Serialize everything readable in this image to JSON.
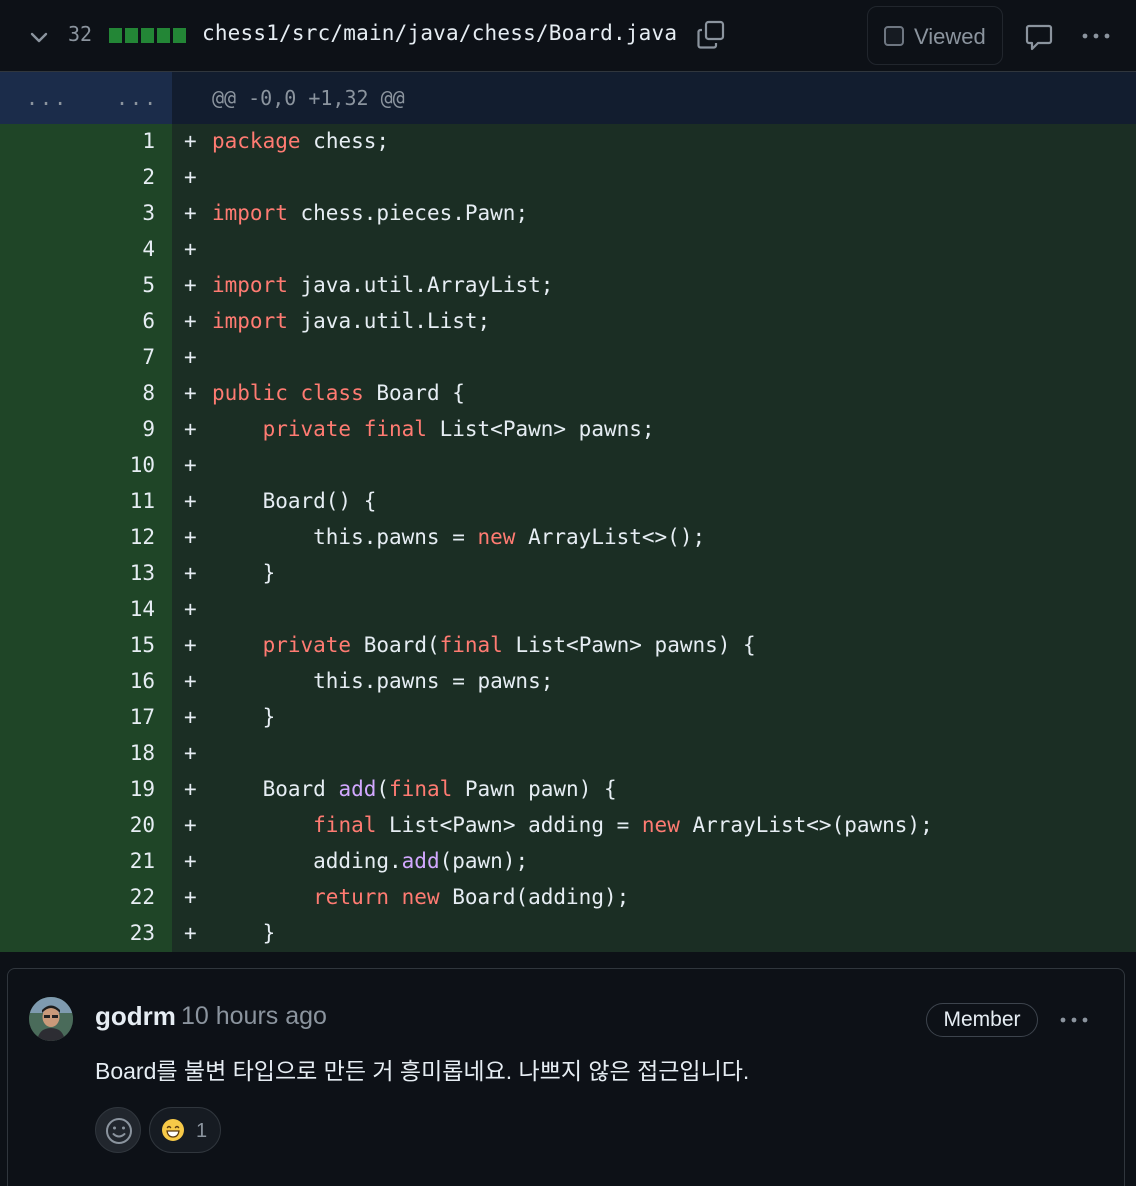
{
  "file": {
    "additions": "32",
    "path": "chess1/src/main/java/chess/Board.java",
    "viewed_label": "Viewed"
  },
  "hunk": {
    "old_marker": "...",
    "new_marker": "...",
    "header": "@@ -0,0 +1,32 @@"
  },
  "lines": [
    {
      "n": "1",
      "code": [
        [
          "kw",
          "package"
        ],
        [
          "",
          "chess;"
        ]
      ]
    },
    {
      "n": "2",
      "code": []
    },
    {
      "n": "3",
      "code": [
        [
          "kw",
          "import"
        ],
        [
          "",
          "chess.pieces.Pawn;"
        ]
      ]
    },
    {
      "n": "4",
      "code": []
    },
    {
      "n": "5",
      "code": [
        [
          "kw",
          "import"
        ],
        [
          "",
          "java.util.ArrayList;"
        ]
      ]
    },
    {
      "n": "6",
      "code": [
        [
          "kw",
          "import"
        ],
        [
          "",
          "java.util.List;"
        ]
      ]
    },
    {
      "n": "7",
      "code": []
    },
    {
      "n": "8",
      "code": [
        [
          "kw",
          "public class"
        ],
        [
          "",
          "Board {"
        ]
      ]
    },
    {
      "n": "9",
      "code": [
        [
          "",
          "    "
        ],
        [
          "kw",
          "private final"
        ],
        [
          "",
          "List<Pawn> pawns;"
        ]
      ]
    },
    {
      "n": "10",
      "code": []
    },
    {
      "n": "11",
      "code": [
        [
          "",
          "    Board() {"
        ]
      ]
    },
    {
      "n": "12",
      "code": [
        [
          "",
          "        this.pawns = "
        ],
        [
          "kw",
          "new"
        ],
        [
          "",
          "ArrayList<>();"
        ]
      ]
    },
    {
      "n": "13",
      "code": [
        [
          "",
          "    }"
        ]
      ]
    },
    {
      "n": "14",
      "code": []
    },
    {
      "n": "15",
      "code": [
        [
          "",
          "    "
        ],
        [
          "kw",
          "private"
        ],
        [
          "",
          "Board("
        ],
        [
          "kw",
          "final"
        ],
        [
          "",
          "List<Pawn> pawns) {"
        ]
      ]
    },
    {
      "n": "16",
      "code": [
        [
          "",
          "        this.pawns = pawns;"
        ]
      ]
    },
    {
      "n": "17",
      "code": [
        [
          "",
          "    }"
        ]
      ]
    },
    {
      "n": "18",
      "code": []
    },
    {
      "n": "19",
      "code": [
        [
          "",
          "    Board "
        ],
        [
          "fn",
          "add"
        ],
        [
          "",
          "("
        ],
        [
          "kw",
          "final"
        ],
        [
          "",
          "Pawn pawn) {"
        ]
      ]
    },
    {
      "n": "20",
      "code": [
        [
          "",
          "        "
        ],
        [
          "kw",
          "final"
        ],
        [
          "",
          "List<Pawn> adding = "
        ],
        [
          "kw",
          "new"
        ],
        [
          "",
          "ArrayList<>(pawns);"
        ]
      ]
    },
    {
      "n": "21",
      "code": [
        [
          "",
          "        adding."
        ],
        [
          "fn",
          "add"
        ],
        [
          "",
          "(pawn);"
        ]
      ]
    },
    {
      "n": "22",
      "code": [
        [
          "",
          "        "
        ],
        [
          "kw",
          "return new"
        ],
        [
          "",
          "Board(adding);"
        ]
      ]
    },
    {
      "n": "23",
      "code": [
        [
          "",
          "    }"
        ]
      ]
    }
  ],
  "plus_sign": "+",
  "comment": {
    "author": "godrm",
    "time": "10 hours ago",
    "role": "Member",
    "body": "Board를 불변 타입으로 만든 거 흥미롭네요. 나쁘지 않은 접근입니다.",
    "reaction_count": "1",
    "reaction_icon": "grinning-face-icon"
  }
}
